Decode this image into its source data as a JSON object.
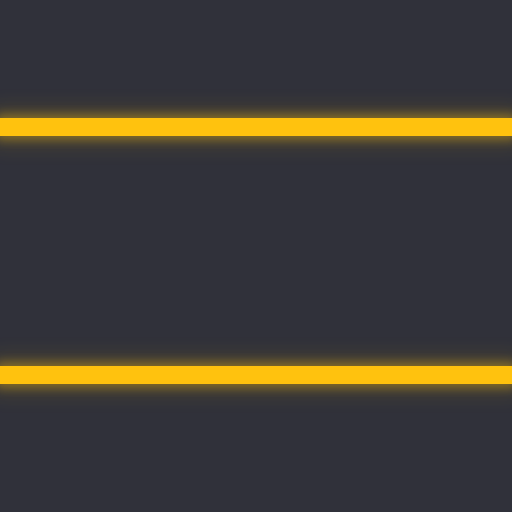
{
  "background": {
    "color": "#30313a"
  },
  "lines": [
    {
      "name": "glow-line-top",
      "color": "#ffc20e",
      "glow": true
    },
    {
      "name": "glow-line-bottom",
      "color": "#ffc20e",
      "glow": true
    }
  ]
}
